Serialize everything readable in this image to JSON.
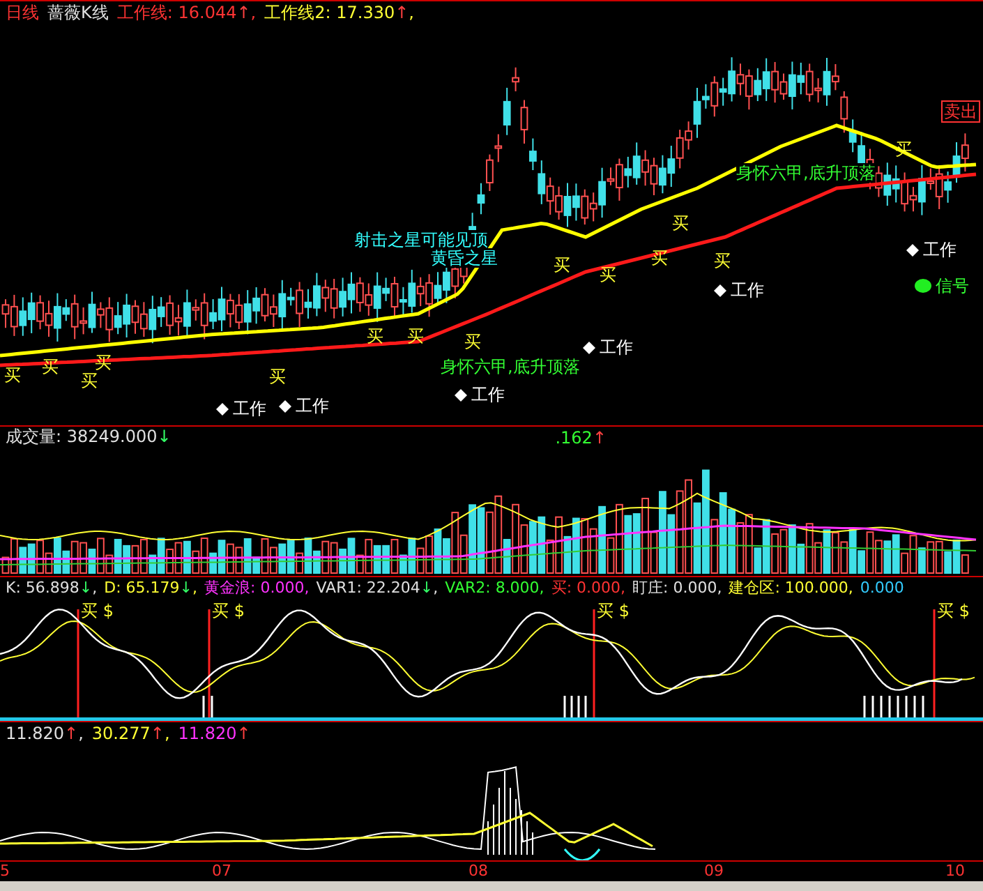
{
  "main_panel": {
    "legend": [
      {
        "text": "日线",
        "color": "#ff3333"
      },
      {
        "text": "蔷薇K线",
        "color": "#e0e0e0"
      },
      {
        "text": "工作线: 16.044",
        "color": "#ff3333",
        "arrow": {
          "text": "↑",
          "color": "#ff4040"
        },
        "after": ","
      },
      {
        "text": "工作线2: 17.330",
        "color": "#ffff33",
        "arrow": {
          "text": "↑",
          "color": "#ff4040"
        },
        "after": ","
      }
    ],
    "annotations": [
      {
        "text": "买",
        "kind": "buy"
      },
      {
        "text": "买",
        "kind": "buy"
      },
      {
        "text": "买",
        "kind": "buy"
      },
      {
        "text": "买",
        "kind": "buy"
      },
      {
        "text": "买",
        "kind": "buy"
      },
      {
        "text": "买",
        "kind": "buy"
      },
      {
        "text": "买",
        "kind": "buy"
      },
      {
        "text": "买",
        "kind": "buy"
      },
      {
        "text": "买",
        "kind": "buy"
      },
      {
        "text": "买",
        "kind": "buy"
      },
      {
        "text": "买",
        "kind": "buy"
      },
      {
        "text": "买",
        "kind": "buy"
      },
      {
        "text": "买",
        "kind": "buy"
      },
      {
        "text": "买",
        "kind": "buy"
      },
      {
        "text": "工作",
        "kind": "work"
      },
      {
        "text": "工作",
        "kind": "work"
      },
      {
        "text": "工作",
        "kind": "work"
      },
      {
        "text": "工作",
        "kind": "work"
      },
      {
        "text": "工作",
        "kind": "work"
      },
      {
        "text": "工作",
        "kind": "work"
      },
      {
        "text": "射击之星可能见顶",
        "kind": "pattern_cyan"
      },
      {
        "text": "黄昏之星",
        "kind": "pattern_cyan"
      },
      {
        "text": "身怀六甲,底升顶落",
        "kind": "pattern_green"
      },
      {
        "text": "身怀六甲,底升顶落",
        "kind": "pattern_green"
      },
      {
        "text": "信号",
        "kind": "signal"
      },
      {
        "text": "卖出",
        "kind": "sell"
      }
    ]
  },
  "volume_panel": {
    "legend": [
      {
        "text": "成交量: 38249.000",
        "color": "#e0e0e0",
        "arrow": {
          "text": "↓",
          "color": "#33ff66"
        }
      },
      {
        "text": ".162",
        "color": "#33ff33",
        "arrow": {
          "text": "↑",
          "color": "#ff4040"
        }
      }
    ]
  },
  "kdj_panel": {
    "legend": [
      {
        "text": "K: 56.898",
        "color": "#e0e0e0",
        "arrow": {
          "text": "↓",
          "color": "#33ff66"
        },
        "after": ","
      },
      {
        "text": "D: 65.179",
        "color": "#ffff33",
        "arrow": {
          "text": "↓",
          "color": "#33ff66"
        },
        "after": ","
      },
      {
        "text": "黄金浪: 0.000,",
        "color": "#ff33ff"
      },
      {
        "text": "VAR1: 22.204",
        "color": "#e0e0e0",
        "arrow": {
          "text": "↓",
          "color": "#33ff66"
        },
        "after": ","
      },
      {
        "text": "VAR2: 8.000,",
        "color": "#33ff33"
      },
      {
        "text": "买: 0.000,",
        "color": "#ff3333"
      },
      {
        "text": "盯庄: 0.000,",
        "color": "#e0e0e0"
      },
      {
        "text": "建仓区: 100.000,",
        "color": "#ffff33"
      },
      {
        "text": "0.000",
        "color": "#33ccff"
      }
    ],
    "signals": [
      {
        "text": "买 $"
      },
      {
        "text": "买 $"
      },
      {
        "text": "买 $"
      },
      {
        "text": "买 $"
      }
    ]
  },
  "oscillator_panel": {
    "legend": [
      {
        "text": "11.820",
        "color": "#e0e0e0",
        "arrow": {
          "text": "↑",
          "color": "#ff4040"
        },
        "after": ","
      },
      {
        "text": "30.277",
        "color": "#ffff33",
        "arrow": {
          "text": "↑",
          "color": "#ff4040"
        },
        "after": ","
      },
      {
        "text": "11.820",
        "color": "#ff33ff",
        "arrow": {
          "text": "↑",
          "color": "#ff4040"
        }
      }
    ]
  },
  "time_axis": {
    "labels": [
      "5",
      "07",
      "08",
      "09",
      "10"
    ]
  }
}
